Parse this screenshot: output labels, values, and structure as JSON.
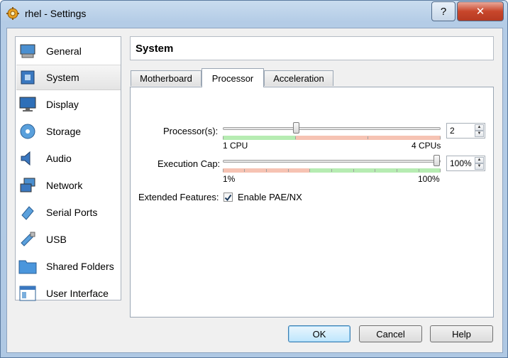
{
  "window": {
    "title": "rhel - Settings",
    "help_label": "?",
    "close_label": "✕"
  },
  "sidebar": {
    "items": [
      {
        "label": "General"
      },
      {
        "label": "System"
      },
      {
        "label": "Display"
      },
      {
        "label": "Storage"
      },
      {
        "label": "Audio"
      },
      {
        "label": "Network"
      },
      {
        "label": "Serial Ports"
      },
      {
        "label": "USB"
      },
      {
        "label": "Shared Folders"
      },
      {
        "label": "User Interface"
      }
    ],
    "selected": "System"
  },
  "page": {
    "title": "System"
  },
  "tabs": [
    {
      "label": "Motherboard"
    },
    {
      "label": "Processor"
    },
    {
      "label": "Acceleration"
    }
  ],
  "processor": {
    "processors_label": "Processor(s):",
    "processors_value": "2",
    "processors_min_label": "1 CPU",
    "processors_max_label": "4 CPUs",
    "exec_cap_label": "Execution Cap:",
    "exec_cap_value": "100%",
    "exec_cap_min_label": "1%",
    "exec_cap_max_label": "100%",
    "extended_label": "Extended Features:",
    "pae_label": "Enable PAE/NX",
    "pae_checked": true
  },
  "buttons": {
    "ok": "OK",
    "cancel": "Cancel",
    "help": "Help"
  },
  "colors": {
    "green_range": "#b6ecb2",
    "red_range": "#f6c3b3"
  }
}
